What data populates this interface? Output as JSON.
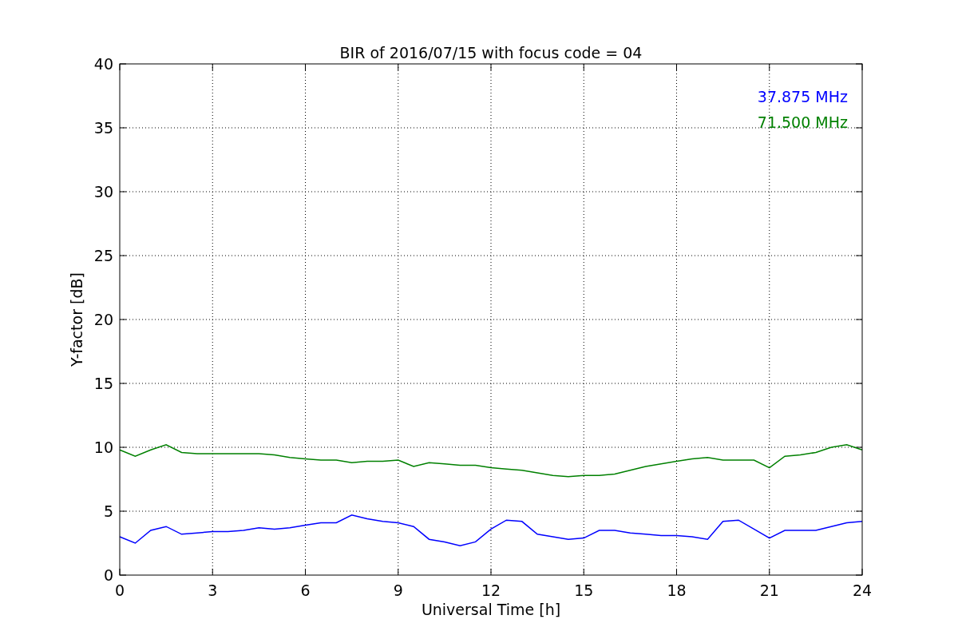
{
  "chart_data": {
    "type": "line",
    "title": "BIR of 2016/07/15 with focus code = 04",
    "xlabel": "Universal Time [h]",
    "ylabel": "Y-factor [dB]",
    "x": [
      0,
      0.5,
      1,
      1.5,
      2,
      2.5,
      3,
      3.5,
      4,
      4.5,
      5,
      5.5,
      6,
      6.5,
      7,
      7.5,
      8,
      8.5,
      9,
      9.5,
      10,
      10.5,
      11,
      11.5,
      12,
      12.5,
      13,
      13.5,
      14,
      14.5,
      15,
      15.5,
      16,
      16.5,
      17,
      17.5,
      18,
      18.5,
      19,
      19.5,
      20,
      20.5,
      21,
      21.5,
      22,
      22.5,
      23,
      23.5,
      24
    ],
    "series": [
      {
        "name": "37.875 MHz",
        "color": "#0000ff",
        "values": [
          3.0,
          2.5,
          3.5,
          3.8,
          3.2,
          3.3,
          3.4,
          3.4,
          3.5,
          3.7,
          3.6,
          3.7,
          3.9,
          4.1,
          4.1,
          4.7,
          4.4,
          4.2,
          4.1,
          3.8,
          2.8,
          2.6,
          2.3,
          2.6,
          3.6,
          4.3,
          4.2,
          3.2,
          3.0,
          2.8,
          2.9,
          3.5,
          3.5,
          3.3,
          3.2,
          3.1,
          3.1,
          3.0,
          2.8,
          4.2,
          4.3,
          3.6,
          2.9,
          3.5,
          3.5,
          3.5,
          3.8,
          4.1,
          4.2
        ]
      },
      {
        "name": "71.500 MHz",
        "color": "#008000",
        "values": [
          9.8,
          9.3,
          9.8,
          10.2,
          9.6,
          9.5,
          9.5,
          9.5,
          9.5,
          9.5,
          9.4,
          9.2,
          9.1,
          9.0,
          9.0,
          8.8,
          8.9,
          8.9,
          9.0,
          8.5,
          8.8,
          8.7,
          8.6,
          8.6,
          8.4,
          8.3,
          8.2,
          8.0,
          7.8,
          7.7,
          7.8,
          7.8,
          7.9,
          8.2,
          8.5,
          8.7,
          8.9,
          9.1,
          9.2,
          9.0,
          9.0,
          9.0,
          8.4,
          9.3,
          9.4,
          9.6,
          10.0,
          10.2,
          9.8
        ]
      }
    ],
    "xlim": [
      0,
      24
    ],
    "ylim": [
      0,
      40
    ],
    "xticks": [
      0,
      3,
      6,
      9,
      12,
      15,
      18,
      21,
      24
    ],
    "yticks": [
      0,
      5,
      10,
      15,
      20,
      25,
      30,
      35,
      40
    ],
    "grid": true
  }
}
